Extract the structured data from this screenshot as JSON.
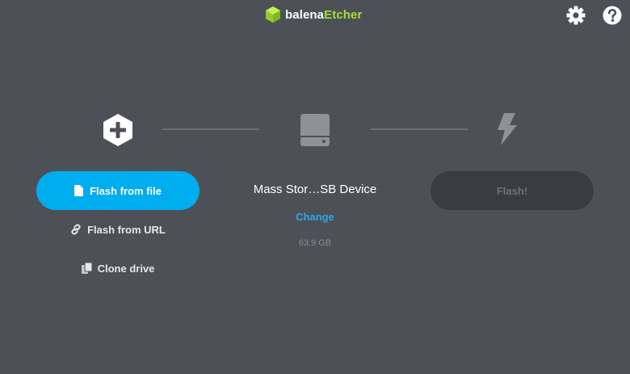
{
  "app": {
    "logo_prefix": "balena",
    "logo_suffix": "Etcher",
    "colors": {
      "background": "#4d5057",
      "accent": "#00aeef",
      "brand_green": "#a5de37",
      "link": "#2ea8e5",
      "disabled_button": "#3a3c41"
    }
  },
  "header": {
    "settings_icon": "gear-icon",
    "help_icon": "question-circle-icon"
  },
  "steps": {
    "source_icon": "plus-hexagon-icon",
    "target_icon": "drive-icon",
    "flash_icon": "lightning-icon"
  },
  "source": {
    "flash_from_file": "Flash from file",
    "flash_from_url": "Flash from URL",
    "clone_drive": "Clone drive"
  },
  "target": {
    "device_name": "Mass Stor…SB Device",
    "change_label": "Change",
    "size": "63.9 GB"
  },
  "flash": {
    "label": "Flash!"
  }
}
